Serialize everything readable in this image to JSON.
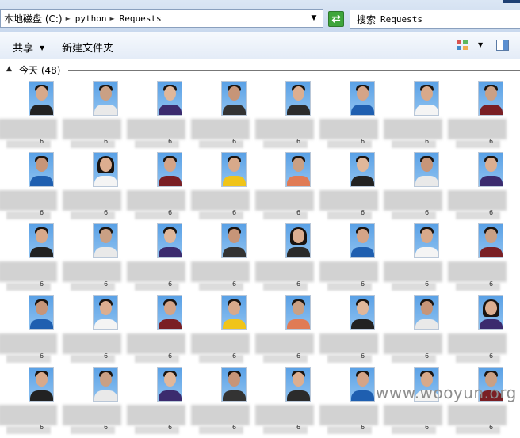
{
  "address_bar": {
    "path": [
      "本地磁盘 (C:)",
      "python",
      "Requests"
    ]
  },
  "search": {
    "label": "搜索",
    "location": "Requests"
  },
  "toolbar": {
    "share_label": "共享",
    "new_folder_label": "新建文件夹"
  },
  "group": {
    "label": "今天 (48)"
  },
  "files": {
    "count": 48,
    "rows": 5,
    "columns": 8,
    "visible_name_fragment_digit": "6"
  },
  "watermark": "www.wooyun.org",
  "colors": {
    "photo_background": "#5aa1e6",
    "refresh_button": "#3ea53b",
    "address_band": "#c9d9ee"
  }
}
